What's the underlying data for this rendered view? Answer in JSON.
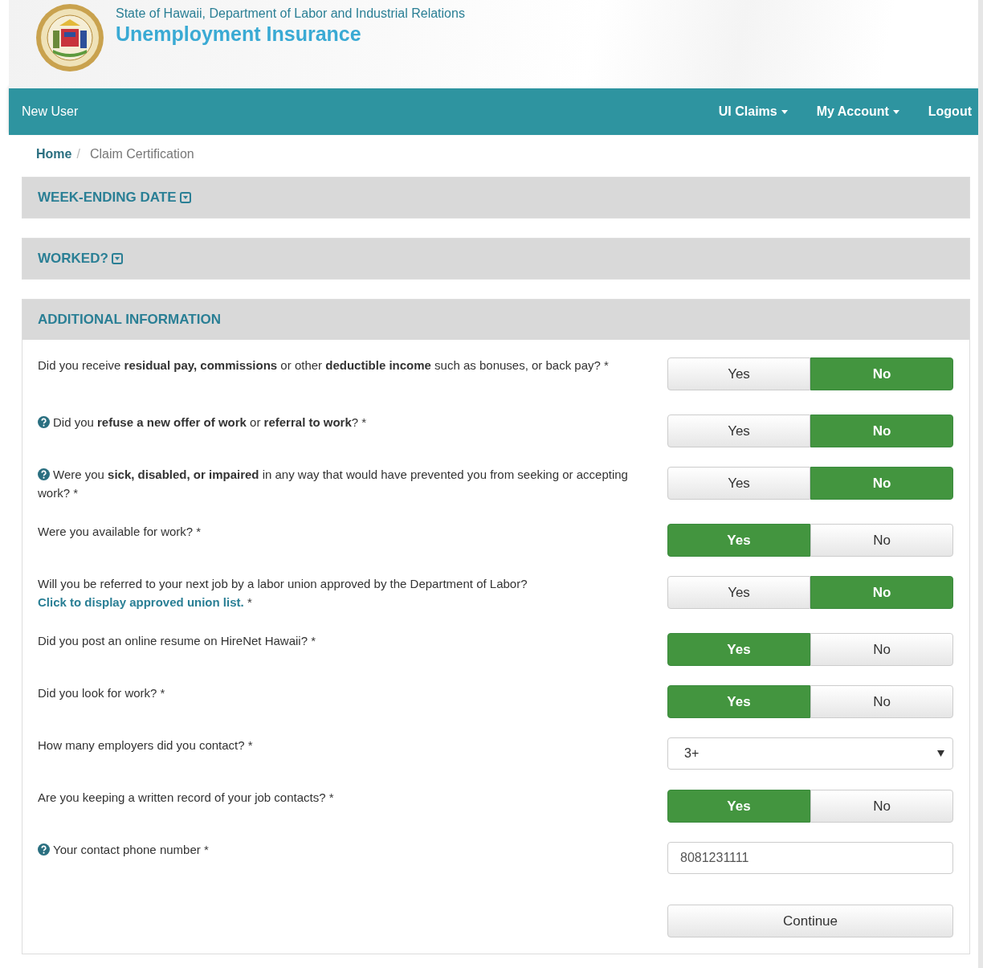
{
  "header": {
    "agency": "State of Hawaii, Department of Labor and Industrial Relations",
    "title": "Unemployment Insurance"
  },
  "navbar": {
    "brand": "New User",
    "menus": [
      {
        "label": "UI Claims",
        "dropdown": true
      },
      {
        "label": "My Account",
        "dropdown": true
      },
      {
        "label": "Logout",
        "dropdown": false
      }
    ]
  },
  "breadcrumb": {
    "separator": "/",
    "items": [
      {
        "label": "Home",
        "link": true
      },
      {
        "label": "Claim Certification",
        "link": false
      }
    ]
  },
  "sections": [
    {
      "title": "WEEK-ENDING DATE",
      "collapsed": true
    },
    {
      "title": "WORKED?",
      "collapsed": true
    }
  ],
  "form": {
    "title": "ADDITIONAL INFORMATION",
    "questions": [
      {
        "kind": "toggle",
        "help": false,
        "text": "Did you receive **residual pay, commissions** or other **deductible income** such as bonuses, or back pay? *",
        "options": [
          {
            "label": "Yes",
            "selected": false
          },
          {
            "label": "No",
            "selected": true
          }
        ]
      },
      {
        "kind": "toggle",
        "help": true,
        "text": "Did you **refuse a new offer of work** or **referral to work**? *",
        "options": [
          {
            "label": "Yes",
            "selected": false
          },
          {
            "label": "No",
            "selected": true
          }
        ]
      },
      {
        "kind": "toggle",
        "help": true,
        "text": "Were you **sick, disabled, or impaired** in any way that would have prevented you from seeking or accepting work? *",
        "options": [
          {
            "label": "Yes",
            "selected": false
          },
          {
            "label": "No",
            "selected": true
          }
        ]
      },
      {
        "kind": "toggle",
        "help": false,
        "text": "Were you available for work? *",
        "options": [
          {
            "label": "Yes",
            "selected": true
          },
          {
            "label": "No",
            "selected": false
          }
        ]
      },
      {
        "kind": "toggle",
        "help": false,
        "text": "Will you be referred to your next job by a labor union approved by the Department of Labor?",
        "link": "Click to display approved union list.",
        "suffix": " *",
        "options": [
          {
            "label": "Yes",
            "selected": false
          },
          {
            "label": "No",
            "selected": true
          }
        ]
      },
      {
        "kind": "toggle",
        "help": false,
        "text": "Did you post an online resume on HireNet Hawaii? *",
        "options": [
          {
            "label": "Yes",
            "selected": true
          },
          {
            "label": "No",
            "selected": false
          }
        ]
      },
      {
        "kind": "toggle",
        "help": false,
        "text": "Did you look for work? *",
        "options": [
          {
            "label": "Yes",
            "selected": true
          },
          {
            "label": "No",
            "selected": false
          }
        ]
      },
      {
        "kind": "select",
        "help": false,
        "text": "How many employers did you contact? *",
        "value": "3+"
      },
      {
        "kind": "toggle",
        "help": false,
        "text": "Are you keeping a written record of your job contacts? *",
        "options": [
          {
            "label": "Yes",
            "selected": true
          },
          {
            "label": "No",
            "selected": false
          }
        ]
      },
      {
        "kind": "input",
        "help": true,
        "text": "Your contact phone number *",
        "value": "8081231111"
      }
    ],
    "submit": "Continue"
  }
}
